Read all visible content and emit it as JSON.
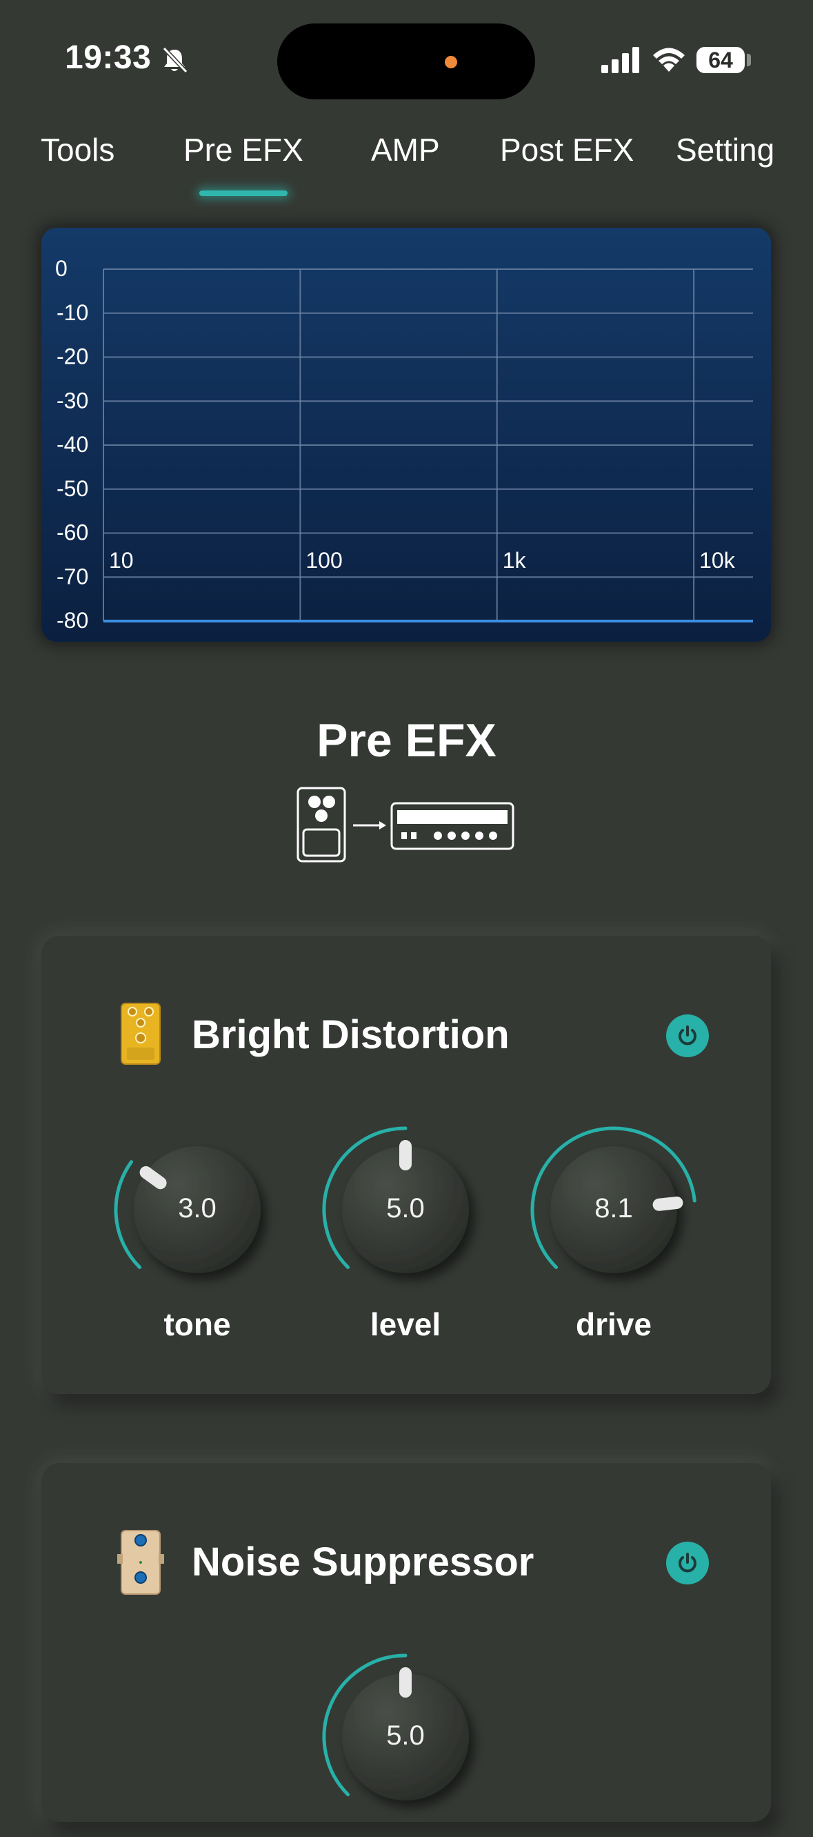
{
  "status_bar": {
    "time": "19:33",
    "battery": "64",
    "icons": [
      "bell-slash-icon",
      "signal-bars-icon",
      "wifi-icon",
      "battery-icon"
    ]
  },
  "tabs": [
    {
      "label": "Tools"
    },
    {
      "label": "Pre EFX",
      "active": true
    },
    {
      "label": "AMP"
    },
    {
      "label": "Post EFX"
    },
    {
      "label": "Setting"
    }
  ],
  "colors": {
    "background": "#353934",
    "accent": "#27b1a8",
    "chart_bg": "#123463",
    "chart_line": "#3d8fe0"
  },
  "chart_data": {
    "type": "line",
    "x_scale": "log",
    "xlim": [
      10,
      20000
    ],
    "ylim": [
      -80,
      0
    ],
    "x_ticks": [
      "10",
      "100",
      "1k",
      "10k"
    ],
    "y_ticks": [
      "0",
      "-10",
      "-20",
      "-30",
      "-40",
      "-50",
      "-60",
      "-70",
      "-80"
    ],
    "grid": true,
    "series": [
      {
        "x": [
          10,
          20000
        ],
        "y": [
          -80,
          -80
        ]
      }
    ]
  },
  "section": {
    "title": "Pre EFX",
    "signal_chain_icons": [
      "pedal-icon",
      "arrow-right-icon",
      "amp-head-icon"
    ]
  },
  "effects": [
    {
      "name": "Bright Distortion",
      "icon": "yellow-pedal-icon",
      "enabled": true,
      "knobs": [
        {
          "label": "tone",
          "value": "3.0",
          "level": 3.0,
          "max": 10
        },
        {
          "label": "level",
          "value": "5.0",
          "level": 5.0,
          "max": 10
        },
        {
          "label": "drive",
          "value": "8.1",
          "level": 8.1,
          "max": 10
        }
      ]
    },
    {
      "name": "Noise Suppressor",
      "icon": "beige-pedal-icon",
      "enabled": true,
      "knobs": [
        {
          "label": "",
          "value": "5.0",
          "level": 5.0,
          "max": 10
        }
      ]
    }
  ]
}
